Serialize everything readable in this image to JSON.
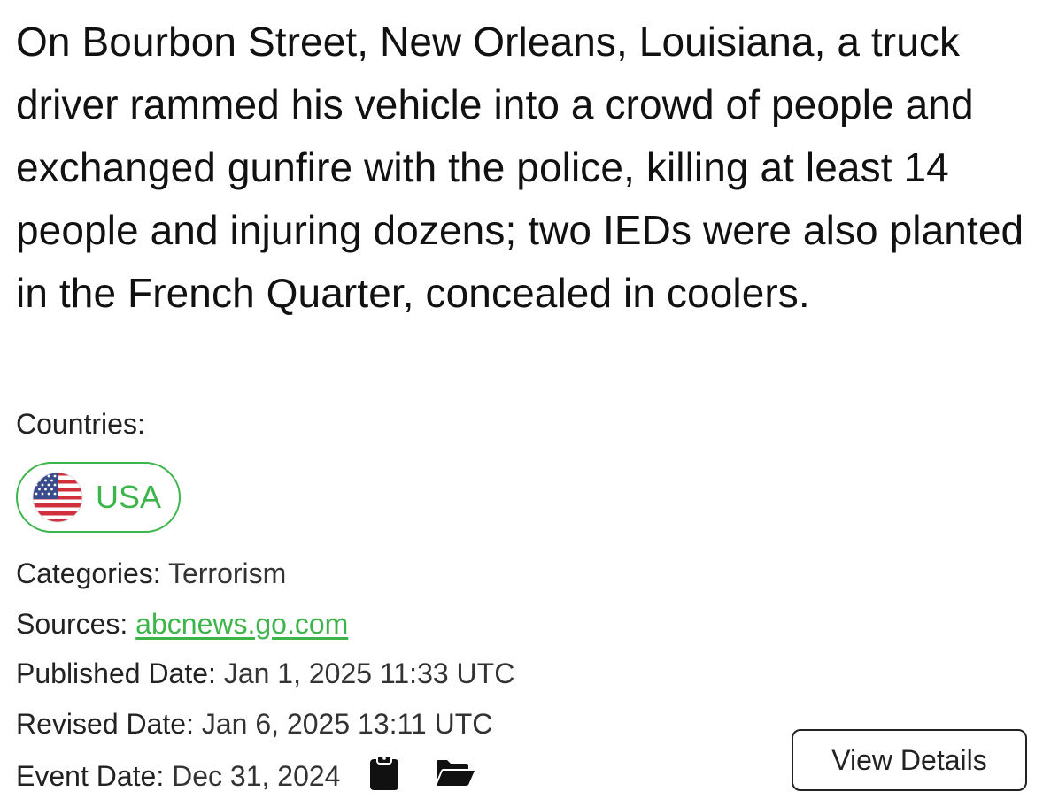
{
  "event": {
    "headline": "On Bourbon Street, New Orleans, Louisiana, a truck driver rammed his vehicle into a crowd of people and exchanged gunfire with the police, killing at least 14 people and injuring dozens; two IEDs were also planted in the French Quarter, concealed in coolers.",
    "countries_label": "Countries:",
    "countries": [
      {
        "name": "USA",
        "icon": "usa-flag-icon"
      }
    ],
    "categories_label": "Categories:",
    "categories_value": "Terrorism",
    "sources_label": "Sources:",
    "sources_value": "abcnews.go.com",
    "published_label": "Published Date:",
    "published_value": "Jan 1, 2025 11:33 UTC",
    "revised_label": "Revised Date:",
    "revised_value": "Jan 6, 2025 13:11 UTC",
    "event_date_label": "Event Date:",
    "event_date_value": "Dec 31, 2024",
    "icons": [
      "clipboard-icon",
      "folder-open-icon"
    ],
    "view_details_label": "View Details"
  },
  "colors": {
    "accent_green": "#3cb54a",
    "text_primary": "#111111",
    "border_dark": "#222222"
  }
}
